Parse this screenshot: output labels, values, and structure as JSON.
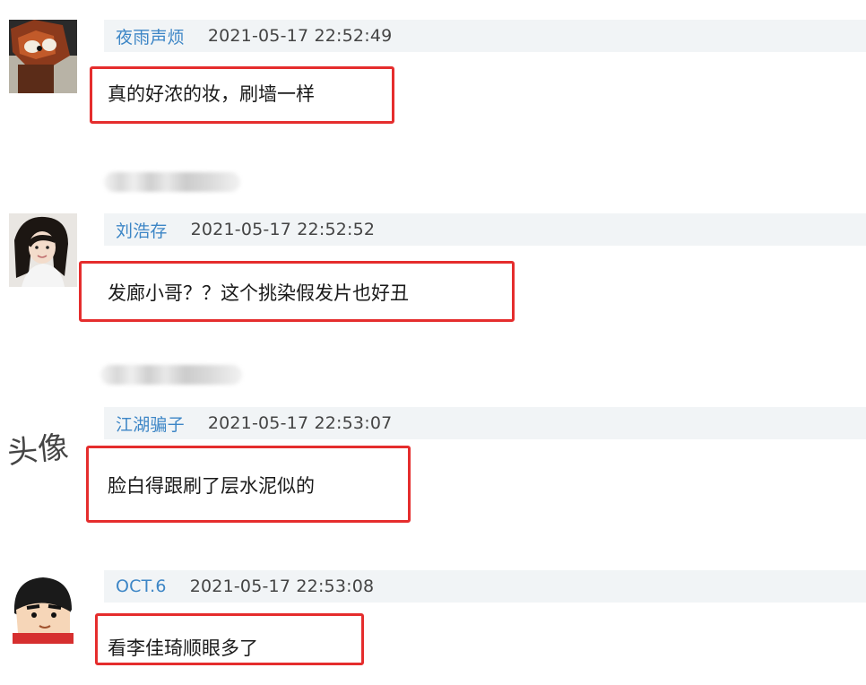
{
  "comments": [
    {
      "username": "夜雨声烦",
      "timestamp": "2021-05-17 22:52:49",
      "text": "真的好浓的妆，刷墙一样",
      "avatar_icon": "red-panda-avatar-icon"
    },
    {
      "username": "刘浩存",
      "timestamp": "2021-05-17 22:52:52",
      "text": "发廊小哥？？这个挑染假发片也好丑",
      "avatar_icon": "woman-portrait-avatar-icon"
    },
    {
      "username": "江湖骗子",
      "timestamp": "2021-05-17 22:53:07",
      "text": "脸白得跟刷了层水泥似的",
      "avatar_icon": "handwritten-avatar-icon",
      "avatar_text": "头像"
    },
    {
      "username": "OCT.6",
      "timestamp": "2021-05-17 22:53:08",
      "text": "看李佳琦顺眼多了",
      "avatar_icon": "cartoon-boy-avatar-icon"
    }
  ],
  "colors": {
    "username": "#3d86c6",
    "meta_background": "#f1f4f6",
    "highlight_border": "#e52d2d",
    "text": "#1a1a1a"
  }
}
